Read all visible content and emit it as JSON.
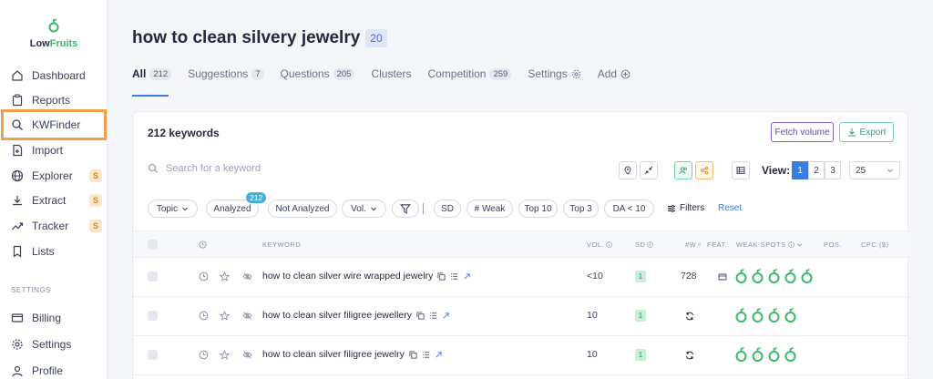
{
  "logo": {
    "low": "Low",
    "fruits": "Fruits"
  },
  "sidebar": {
    "items": [
      {
        "label": "Dashboard",
        "icon": "home-icon"
      },
      {
        "label": "Reports",
        "icon": "clipboard-icon"
      },
      {
        "label": "KWFinder",
        "icon": "search-icon",
        "active": true
      },
      {
        "label": "Import",
        "icon": "file-plus-icon"
      },
      {
        "label": "Explorer",
        "icon": "globe-icon",
        "badge": "S"
      },
      {
        "label": "Extract",
        "icon": "download-icon",
        "badge": "S"
      },
      {
        "label": "Tracker",
        "icon": "trend-icon",
        "badge": "S"
      },
      {
        "label": "Lists",
        "icon": "bookmark-icon"
      }
    ],
    "settings_label": "SETTINGS",
    "settings_items": [
      {
        "label": "Billing",
        "icon": "card-icon"
      },
      {
        "label": "Settings",
        "icon": "gear-icon"
      },
      {
        "label": "Profile",
        "icon": "user-icon"
      }
    ]
  },
  "page": {
    "title": "how to clean silvery jewelry",
    "title_count": "20"
  },
  "tabs": [
    {
      "label": "All",
      "count": "212"
    },
    {
      "label": "Suggestions",
      "count": "7"
    },
    {
      "label": "Questions",
      "count": "205"
    },
    {
      "label": "Clusters",
      "count": ""
    },
    {
      "label": "Competition",
      "count": "259"
    },
    {
      "label": "Settings",
      "count": ""
    },
    {
      "label": "Add",
      "count": ""
    }
  ],
  "card": {
    "keyword_count": "212 keywords",
    "fetch_label": "Fetch volume",
    "export_label": "Export",
    "search_placeholder": "Search for a keyword",
    "view_label": "View:",
    "pages": [
      "1",
      "2",
      "3"
    ],
    "per_page": "25",
    "reset_label": "Reset",
    "filters_label": "Filters"
  },
  "chips": {
    "topic": "Topic",
    "analyzed": "Analyzed",
    "analyzed_badge": "212",
    "not_analyzed": "Not Analyzed",
    "vol": "Vol.",
    "sd": "SD",
    "weak": "# Weak",
    "top10": "Top 10",
    "top3": "Top 3",
    "da": "DA < 10"
  },
  "table": {
    "headers": {
      "keyword": "KEYWORD",
      "vol": "VOL.",
      "sd": "SD",
      "wc": "#W",
      "wc_sup": "c",
      "feat": "FEAT.",
      "weak": "WEAK SPOTS",
      "pos": "POS.",
      "cpc": "CPC ($)"
    },
    "rows": [
      {
        "keyword": "how to clean silver wire wrapped jewelry",
        "vol": "<10",
        "sd": "1",
        "wc": "728",
        "spots": 5,
        "feat": true
      },
      {
        "keyword": "how to clean silver filigree jewellery",
        "vol": "10",
        "sd": "1",
        "wc": "",
        "spots": 4,
        "feat": false
      },
      {
        "keyword": "how to clean silver filigree jewelry",
        "vol": "10",
        "sd": "1",
        "wc": "",
        "spots": 4,
        "feat": false
      }
    ]
  },
  "colors": {
    "accent": "#3a7de0",
    "highlight": "#f0a04b",
    "green": "#3aba6a"
  }
}
